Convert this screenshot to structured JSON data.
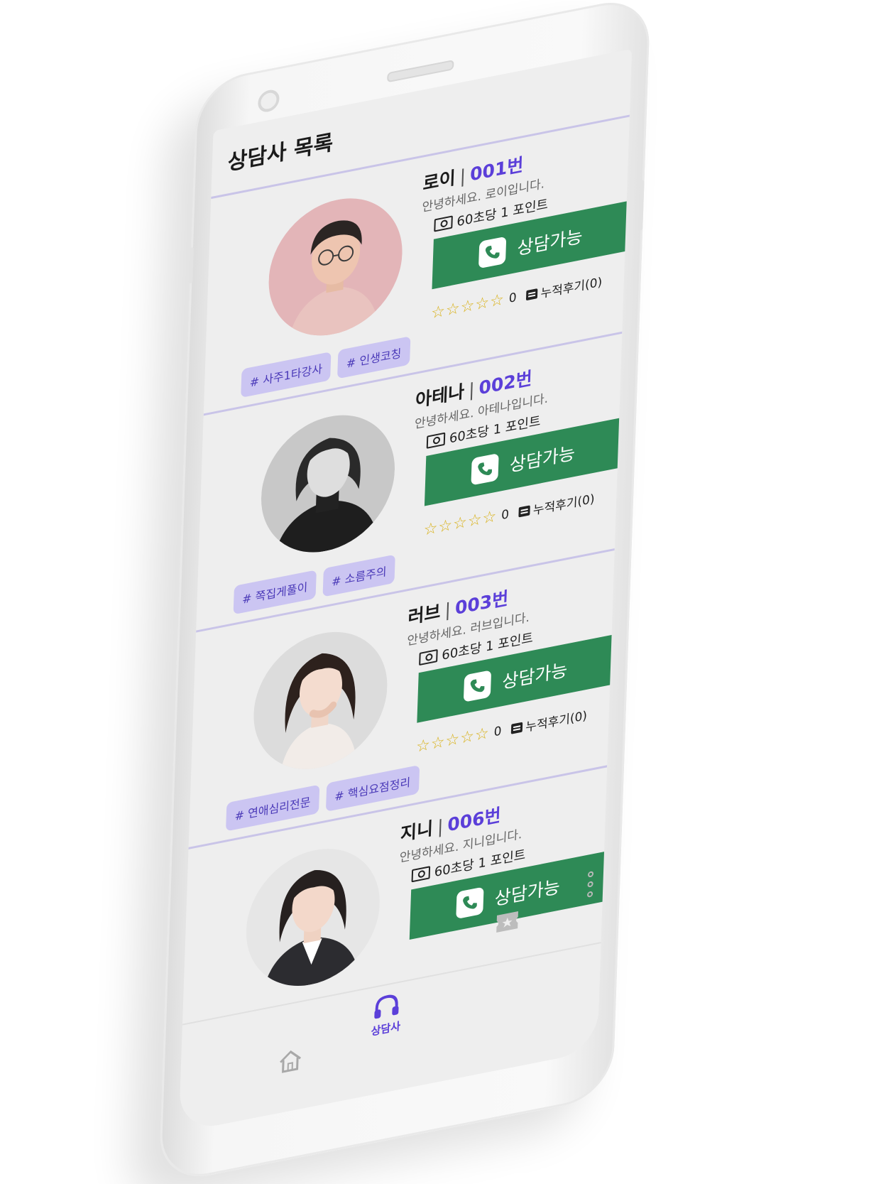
{
  "header": {
    "title": "상담사 목록"
  },
  "counselors": [
    {
      "name": "로이",
      "separator": "|",
      "number": "001번",
      "greeting": "안녕하세요. 로이입니다.",
      "price": "60초당 1 포인트",
      "call_label": "상담가능",
      "stars": "☆☆☆☆☆",
      "rating": "0",
      "reviews": "누적후기(0)",
      "tags": [
        "# 사주1타강사",
        "# 인생코칭"
      ]
    },
    {
      "name": "아테나",
      "separator": "|",
      "number": "002번",
      "greeting": "안녕하세요. 아테나입니다.",
      "price": "60초당 1 포인트",
      "call_label": "상담가능",
      "stars": "☆☆☆☆☆",
      "rating": "0",
      "reviews": "누적후기(0)",
      "tags": [
        "# 쪽집게풀이",
        "# 소름주의"
      ]
    },
    {
      "name": "러브",
      "separator": "|",
      "number": "003번",
      "greeting": "안녕하세요. 러브입니다.",
      "price": "60초당 1 포인트",
      "call_label": "상담가능",
      "stars": "☆☆☆☆☆",
      "rating": "0",
      "reviews": "누적후기(0)",
      "tags": [
        "# 연애심리전문",
        "# 핵심요점정리"
      ]
    },
    {
      "name": "지니",
      "separator": "|",
      "number": "006번",
      "greeting": "안녕하세요. 지니입니다.",
      "price": "60초당 1 포인트",
      "call_label": "상담가능"
    }
  ],
  "nav": {
    "active_label": "상담사"
  },
  "colors": {
    "accent": "#5b3fd9",
    "call_button": "#2e8a56",
    "tag_bg": "#cbc5f2",
    "divider": "#c9c4e8",
    "star": "#d9b21b"
  },
  "icons": {
    "price": "money-icon",
    "call": "phone-icon",
    "review": "review-icon",
    "nav_home": "home-icon",
    "nav_counselor": "headset-icon",
    "nav_ticket": "ticket-icon",
    "more": "more-dots-icon"
  }
}
